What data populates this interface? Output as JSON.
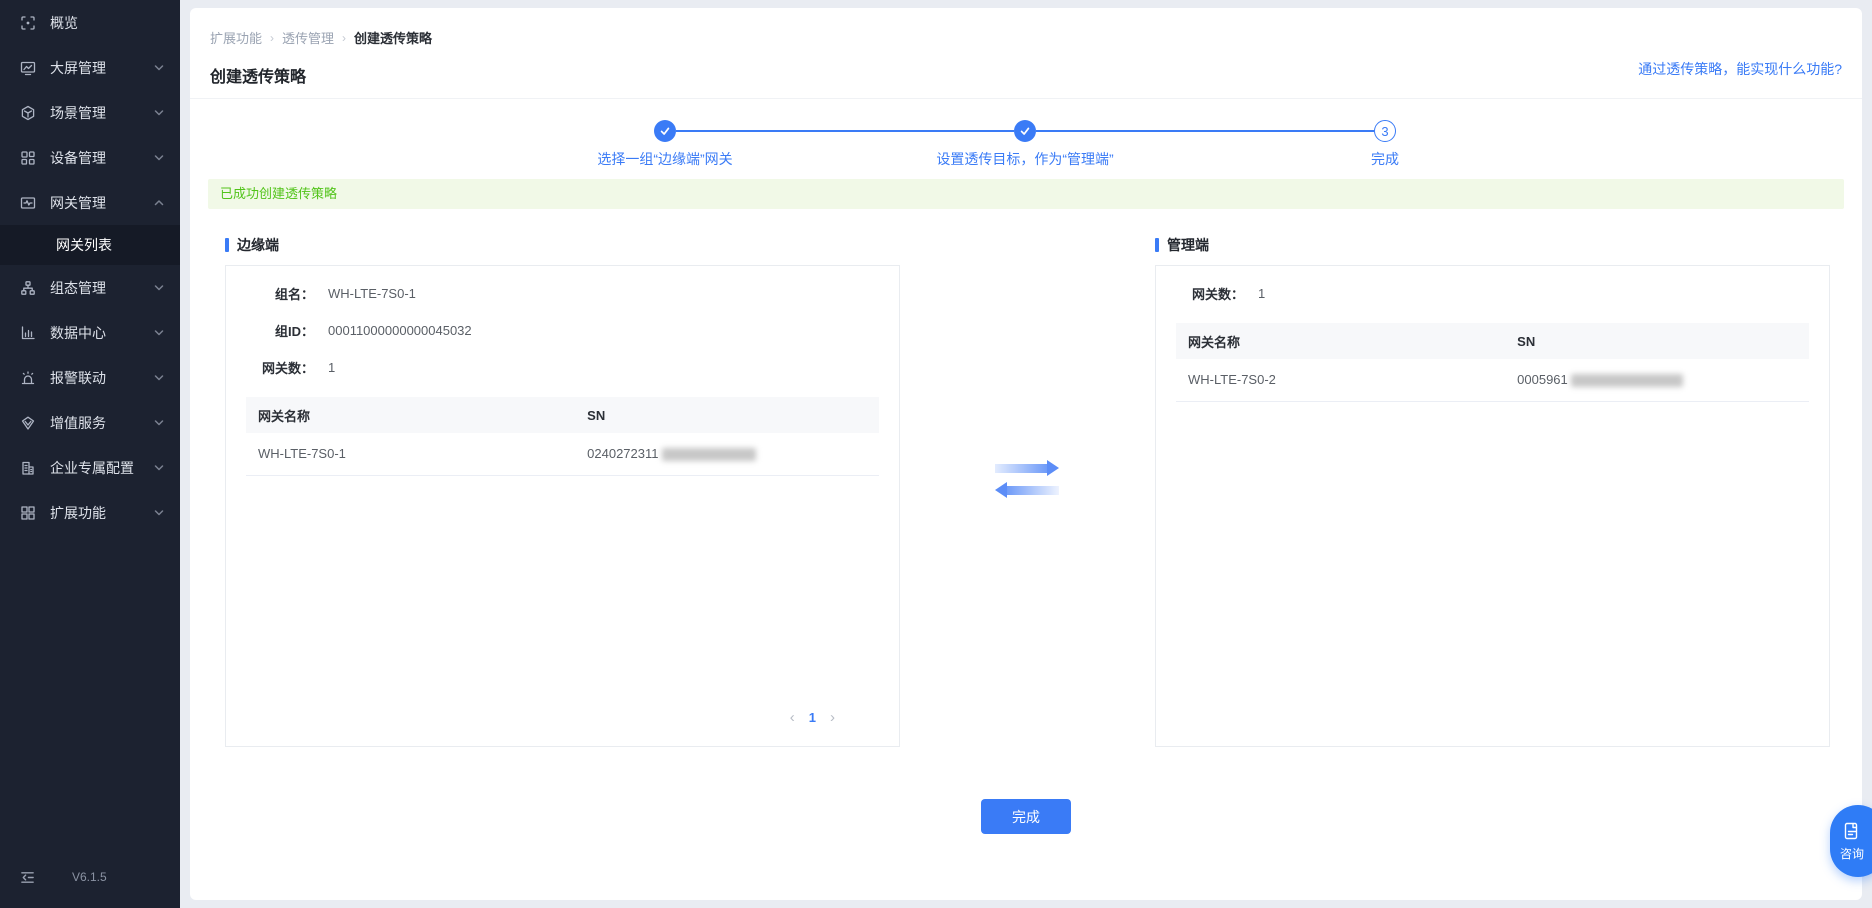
{
  "colors": {
    "accent": "#3a7bf6",
    "success_text": "#52c41a",
    "success_bg": "#f1f9e7",
    "sidebar_bg": "#1c2230"
  },
  "sidebar": {
    "items": [
      {
        "label": "概览",
        "icon": "overview-icon",
        "expandable": false
      },
      {
        "label": "大屏管理",
        "icon": "bigscreen-icon",
        "expandable": true
      },
      {
        "label": "场景管理",
        "icon": "scene-icon",
        "expandable": true
      },
      {
        "label": "设备管理",
        "icon": "device-icon",
        "expandable": true
      },
      {
        "label": "网关管理",
        "icon": "gateway-icon",
        "expandable": true,
        "expanded": true
      },
      {
        "label": "组态管理",
        "icon": "configuration-icon",
        "expandable": true
      },
      {
        "label": "数据中心",
        "icon": "datacenter-icon",
        "expandable": true
      },
      {
        "label": "报警联动",
        "icon": "alarm-icon",
        "expandable": true
      },
      {
        "label": "增值服务",
        "icon": "vas-icon",
        "expandable": true
      },
      {
        "label": "企业专属配置",
        "icon": "enterprise-icon",
        "expandable": true
      },
      {
        "label": "扩展功能",
        "icon": "extension-icon",
        "expandable": true
      }
    ],
    "active_subitem": "网关列表",
    "version": "V6.1.5"
  },
  "breadcrumb": {
    "items": [
      "扩展功能",
      "透传管理",
      "创建透传策略"
    ],
    "separator": "›"
  },
  "header": {
    "title": "创建透传策略",
    "help_link": "通过透传策略，能实现什么功能?"
  },
  "stepper": {
    "steps": [
      {
        "label": "选择一组“边缘端”网关",
        "state": "done"
      },
      {
        "label": "设置透传目标，作为“管理端”",
        "state": "done"
      },
      {
        "label": "完成",
        "state": "current",
        "number": "3"
      }
    ]
  },
  "alert": {
    "message": "已成功创建透传策略"
  },
  "edge_panel": {
    "title": "边缘端",
    "fields": [
      {
        "label": "组名：",
        "value": "WH-LTE-7S0-1"
      },
      {
        "label": "组ID：",
        "value": "00011000000000045032"
      },
      {
        "label": "网关数：",
        "value": "1"
      }
    ],
    "table": {
      "headers": [
        "网关名称",
        "SN"
      ],
      "rows": [
        {
          "name": "WH-LTE-7S0-1",
          "sn_visible": "0240272311",
          "sn_masked": true
        }
      ]
    },
    "pagination": {
      "prev": "‹",
      "page": "1",
      "next": "›"
    }
  },
  "mgmt_panel": {
    "title": "管理端",
    "fields": [
      {
        "label": "网关数：",
        "value": "1"
      }
    ],
    "table": {
      "headers": [
        "网关名称",
        "SN"
      ],
      "rows": [
        {
          "name": "WH-LTE-7S0-2",
          "sn_visible": "0005961",
          "sn_masked": true
        }
      ]
    }
  },
  "footer": {
    "finish_label": "完成"
  },
  "floating": {
    "consult_label": "咨询"
  }
}
